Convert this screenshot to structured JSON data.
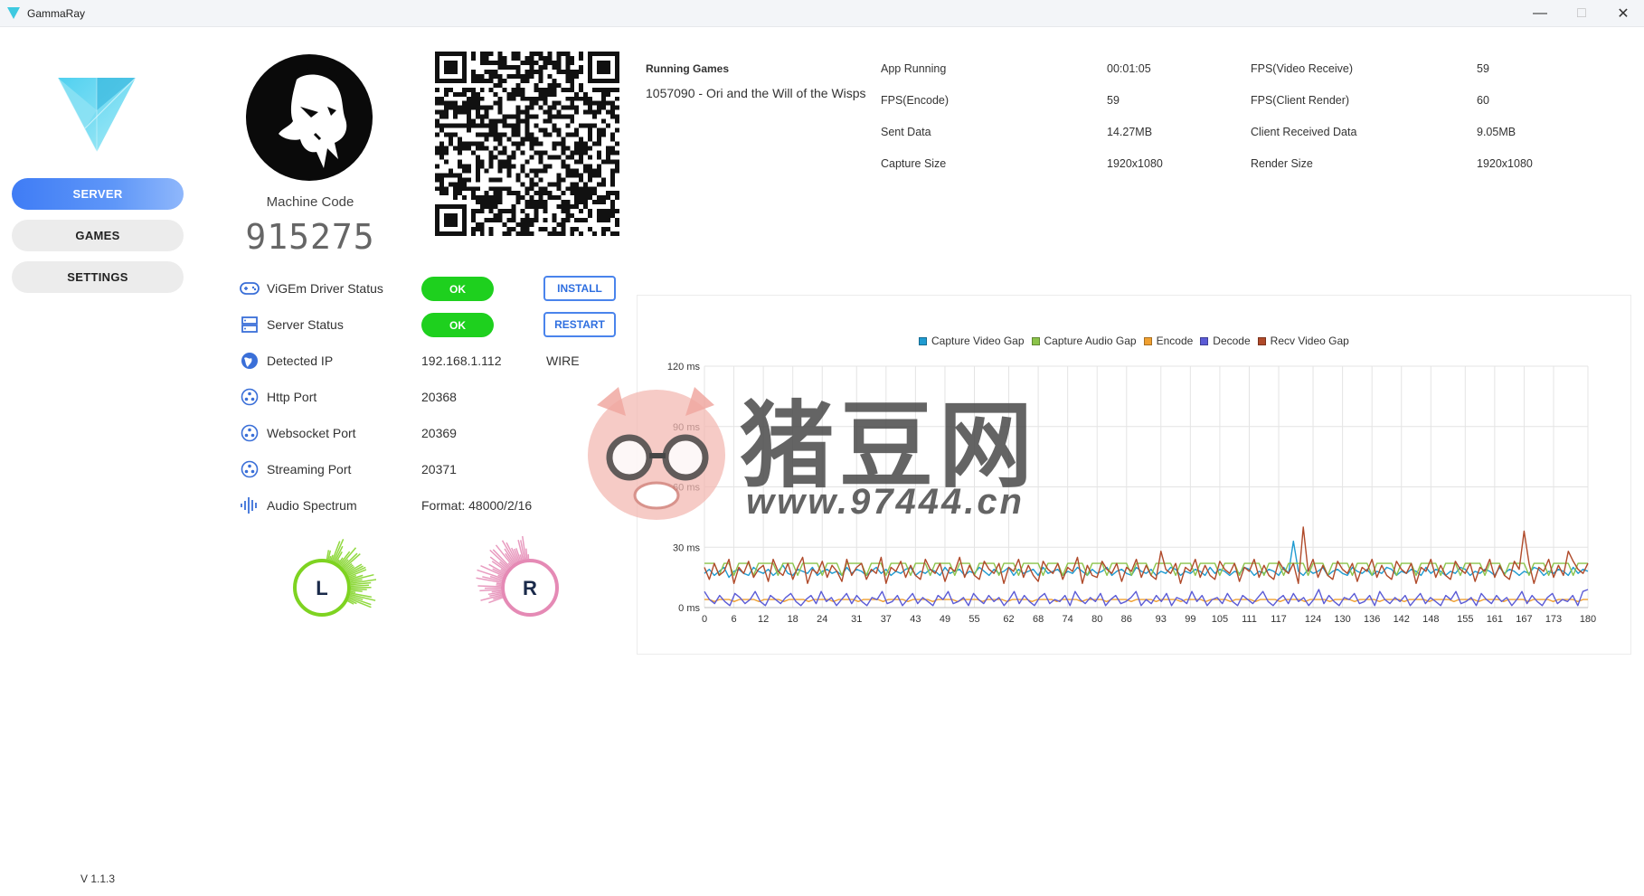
{
  "window": {
    "title": "GammaRay"
  },
  "sidebar": {
    "items": [
      {
        "label": "SERVER",
        "active": true
      },
      {
        "label": "GAMES",
        "active": false
      },
      {
        "label": "SETTINGS",
        "active": false
      }
    ],
    "version": "V 1.1.3"
  },
  "machine": {
    "label": "Machine Code",
    "code": "915275"
  },
  "status": {
    "vigem": {
      "label": "ViGEm Driver Status",
      "state": "OK",
      "action": "INSTALL"
    },
    "server": {
      "label": "Server Status",
      "state": "OK",
      "action": "RESTART"
    },
    "ip": {
      "label": "Detected IP",
      "value": "192.168.1.112",
      "type": "WIRE"
    },
    "http": {
      "label": "Http Port",
      "value": "20368"
    },
    "websocket": {
      "label": "Websocket Port",
      "value": "20369"
    },
    "streaming": {
      "label": "Streaming Port",
      "value": "20371"
    },
    "audio": {
      "label": "Audio Spectrum",
      "value": "Format: 48000/2/16"
    }
  },
  "spectrum": {
    "left": "L",
    "right": "R",
    "left_color": "#7ed321",
    "right_color": "#e58ab5"
  },
  "running_games": {
    "title": "Running Games",
    "items": [
      "1057090 - Ori and the Will of the Wisps"
    ]
  },
  "stats": {
    "app_running": {
      "label": "App Running",
      "value": "00:01:05"
    },
    "fps_encode": {
      "label": "FPS(Encode)",
      "value": "59"
    },
    "sent_data": {
      "label": "Sent Data",
      "value": "14.27MB"
    },
    "capture_size": {
      "label": "Capture Size",
      "value": "1920x1080"
    },
    "fps_video_receive": {
      "label": "FPS(Video Receive)",
      "value": "59"
    },
    "fps_client_render": {
      "label": "FPS(Client Render)",
      "value": "60"
    },
    "client_received": {
      "label": "Client Received Data",
      "value": "9.05MB"
    },
    "render_size": {
      "label": "Render Size",
      "value": "1920x1080"
    }
  },
  "watermark": {
    "title": "猪豆网",
    "url": "www.97444.cn"
  },
  "colors": {
    "accent": "#3f7cf5",
    "ok": "#1ed01e",
    "button_border": "#4a84ec"
  },
  "chart_data": {
    "type": "line",
    "ylim": [
      0,
      120
    ],
    "y_ticks": [
      "0 ms",
      "30 ms",
      "60 ms",
      "90 ms",
      "120 ms"
    ],
    "x_ticks": [
      "0",
      "6",
      "12",
      "18",
      "24",
      "31",
      "37",
      "43",
      "49",
      "55",
      "62",
      "68",
      "74",
      "80",
      "86",
      "93",
      "99",
      "105",
      "111",
      "117",
      "124",
      "130",
      "136",
      "142",
      "148",
      "155",
      "161",
      "167",
      "173",
      "180"
    ],
    "x_max": 180,
    "series": [
      {
        "name": "Capture Video Gap",
        "color": "#1f9bd1",
        "values": [
          17,
          19,
          16,
          18,
          20,
          15,
          18,
          19,
          17,
          16,
          20,
          18,
          17,
          19,
          16,
          18,
          21,
          17,
          16,
          19,
          18,
          17,
          20,
          16,
          18,
          19,
          17,
          18,
          16,
          20,
          17,
          19,
          18,
          16,
          18,
          20,
          17,
          19,
          16,
          18,
          17,
          19,
          20,
          16,
          18,
          17,
          19,
          18,
          16,
          20,
          17,
          18,
          19,
          16,
          18,
          17,
          20,
          18,
          16,
          19,
          17,
          18,
          20,
          16,
          19,
          17,
          18,
          19,
          16,
          20,
          17,
          18,
          19,
          16,
          18,
          17,
          20,
          18,
          16,
          19,
          17,
          18,
          20,
          16,
          18,
          19,
          17,
          16,
          20,
          18,
          17,
          19,
          16,
          18,
          17,
          20,
          19,
          16,
          18,
          17,
          19,
          18,
          16,
          20,
          17,
          19,
          18,
          16,
          18,
          17,
          20,
          19,
          16,
          18,
          17,
          19,
          18,
          16,
          20,
          17,
          33,
          18,
          16,
          19,
          17,
          18,
          20,
          16,
          18,
          19,
          17,
          16,
          20,
          18,
          17,
          19,
          16,
          18,
          17,
          20,
          19,
          16,
          18,
          17,
          19,
          18,
          16,
          20,
          17,
          19,
          18,
          16,
          18,
          17,
          20,
          19,
          16,
          18,
          17,
          19,
          18,
          16,
          20,
          17,
          19,
          18,
          16,
          18,
          17,
          20,
          19,
          16,
          18,
          17,
          19,
          18,
          16,
          20,
          17,
          19,
          18
        ]
      },
      {
        "name": "Capture Audio Gap",
        "color": "#8bc34a",
        "values": [
          22,
          22,
          22,
          16,
          22,
          22,
          16,
          22,
          22,
          22,
          16,
          22,
          22,
          22,
          22,
          16,
          22,
          22,
          22,
          16,
          22,
          22,
          22,
          22,
          16,
          22,
          22,
          22,
          16,
          22,
          22,
          22,
          22,
          16,
          22,
          22,
          22,
          16,
          22,
          22,
          22,
          22,
          16,
          22,
          22,
          22,
          16,
          22,
          22,
          22,
          22,
          16,
          22,
          22,
          22,
          16,
          22,
          22,
          22,
          22,
          16,
          22,
          22,
          22,
          16,
          22,
          22,
          22,
          22,
          16,
          22,
          22,
          22,
          16,
          22,
          22,
          22,
          22,
          16,
          22,
          22,
          22,
          16,
          22,
          22,
          22,
          22,
          16,
          22,
          22,
          22,
          16,
          22,
          22,
          22,
          22,
          16,
          22,
          22,
          22,
          16,
          22,
          22,
          22,
          22,
          16,
          22,
          22,
          22,
          16,
          22,
          22,
          22,
          22,
          16,
          22,
          22,
          22,
          16,
          22,
          22,
          22,
          22,
          16,
          22,
          22,
          22,
          16,
          22,
          22,
          22,
          22,
          16,
          22,
          22,
          22,
          16,
          22,
          22,
          22,
          22,
          16,
          22,
          22,
          22,
          16,
          22,
          22,
          22,
          22,
          16,
          22,
          22,
          22,
          16,
          22,
          22,
          22,
          22,
          16,
          22,
          22,
          22,
          16,
          22,
          22,
          22,
          22,
          16,
          22,
          22,
          22,
          16,
          22,
          22,
          22,
          22,
          16,
          22,
          22,
          22
        ]
      },
      {
        "name": "Encode",
        "color": "#f0a030",
        "values": [
          4,
          4,
          3,
          4,
          4,
          4,
          3,
          4,
          4,
          4,
          4,
          3,
          4,
          4,
          4,
          4,
          3,
          4,
          4,
          4,
          4,
          3,
          4,
          4,
          4,
          4,
          3,
          4,
          4,
          4,
          4,
          3,
          4,
          4,
          4,
          4,
          3,
          4,
          4,
          4,
          4,
          3,
          4,
          4,
          4,
          4,
          3,
          4,
          4,
          4,
          4,
          3,
          4,
          4,
          4,
          4,
          3,
          4,
          4,
          4,
          4,
          3,
          4,
          4,
          4,
          4,
          3,
          4,
          4,
          4,
          4,
          3,
          4,
          4,
          4,
          4,
          3,
          4,
          4,
          4,
          4,
          3,
          4,
          4,
          4,
          4,
          3,
          4,
          4,
          4,
          4,
          3,
          4,
          4,
          4,
          4,
          3,
          4,
          4,
          4,
          4,
          3,
          4,
          4,
          4,
          4,
          3,
          4,
          4,
          4,
          4,
          3,
          4,
          4,
          4,
          4,
          3,
          4,
          4,
          4,
          4,
          3,
          4,
          4,
          4,
          4,
          3,
          4,
          4,
          4,
          4,
          3,
          4,
          4,
          4,
          4,
          3,
          4,
          4,
          4,
          4,
          3,
          4,
          4,
          4,
          4,
          3,
          4,
          4,
          4,
          4,
          3,
          4,
          4,
          4,
          4,
          3,
          4,
          4,
          4,
          4,
          3,
          4,
          4,
          4,
          4,
          3,
          4,
          4,
          4,
          4,
          3,
          4,
          4,
          4,
          4,
          3,
          4,
          4
        ]
      },
      {
        "name": "Decode",
        "color": "#5b5bd6",
        "values": [
          8,
          4,
          2,
          6,
          3,
          1,
          7,
          5,
          2,
          4,
          8,
          3,
          1,
          6,
          4,
          2,
          5,
          7,
          3,
          1,
          4,
          6,
          2,
          8,
          3,
          5,
          1,
          4,
          7,
          2,
          6,
          3,
          1,
          5,
          4,
          8,
          2,
          3,
          6,
          1,
          4,
          7,
          2,
          5,
          3,
          1,
          6,
          4,
          8,
          2,
          3,
          5,
          1,
          7,
          4,
          2,
          6,
          3,
          5,
          1,
          4,
          8,
          2,
          6,
          3,
          1,
          5,
          7,
          2,
          4,
          3,
          6,
          1,
          8,
          4,
          2,
          5,
          3,
          7,
          1,
          4,
          6,
          2,
          3,
          5,
          8,
          1,
          4,
          2,
          6,
          3,
          7,
          1,
          5,
          4,
          2,
          8,
          3,
          6,
          1,
          4,
          5,
          2,
          7,
          3,
          1,
          6,
          4,
          2,
          5,
          8,
          3,
          1,
          4,
          6,
          2,
          7,
          3,
          5,
          1,
          4,
          9,
          2,
          6,
          3,
          1,
          5,
          4,
          7,
          2,
          3,
          6,
          1,
          8,
          4,
          2,
          5,
          3,
          6,
          1,
          4,
          7,
          2,
          5,
          3,
          1,
          6,
          4,
          8,
          2,
          3,
          5,
          1,
          7,
          4,
          2,
          6,
          3,
          5,
          1,
          4,
          8,
          2,
          6,
          3,
          1,
          5,
          7,
          2,
          4,
          3,
          6,
          1,
          8,
          9
        ]
      },
      {
        "name": "Recv Video Gap",
        "color": "#b04a2a",
        "values": [
          20,
          14,
          22,
          16,
          18,
          24,
          12,
          20,
          17,
          23,
          15,
          19,
          21,
          13,
          24,
          18,
          16,
          22,
          14,
          20,
          25,
          12,
          19,
          17,
          23,
          15,
          21,
          18,
          13,
          24,
          16,
          20,
          22,
          14,
          19,
          17,
          25,
          12,
          20,
          18,
          23,
          15,
          21,
          16,
          14,
          24,
          19,
          17,
          22,
          13,
          20,
          18,
          25,
          15,
          21,
          16,
          14,
          23,
          19,
          17,
          22,
          12,
          20,
          18,
          24,
          15,
          21,
          16,
          13,
          23,
          19,
          17,
          22,
          14,
          20,
          18,
          25,
          12,
          21,
          16,
          15,
          23,
          19,
          17,
          22,
          13,
          20,
          18,
          24,
          15,
          21,
          16,
          14,
          28,
          19,
          17,
          22,
          12,
          20,
          18,
          24,
          15,
          21,
          16,
          14,
          23,
          19,
          17,
          22,
          13,
          20,
          18,
          24,
          15,
          21,
          16,
          14,
          23,
          19,
          17,
          22,
          12,
          40,
          18,
          24,
          15,
          21,
          16,
          14,
          23,
          19,
          17,
          22,
          13,
          20,
          18,
          24,
          15,
          21,
          16,
          14,
          23,
          19,
          17,
          22,
          12,
          20,
          18,
          24,
          15,
          21,
          16,
          14,
          23,
          19,
          17,
          22,
          13,
          20,
          18,
          24,
          15,
          21,
          16,
          14,
          23,
          19,
          38,
          22,
          12,
          20,
          18,
          24,
          15,
          21,
          16,
          28,
          23,
          19,
          17,
          22
        ]
      }
    ]
  }
}
